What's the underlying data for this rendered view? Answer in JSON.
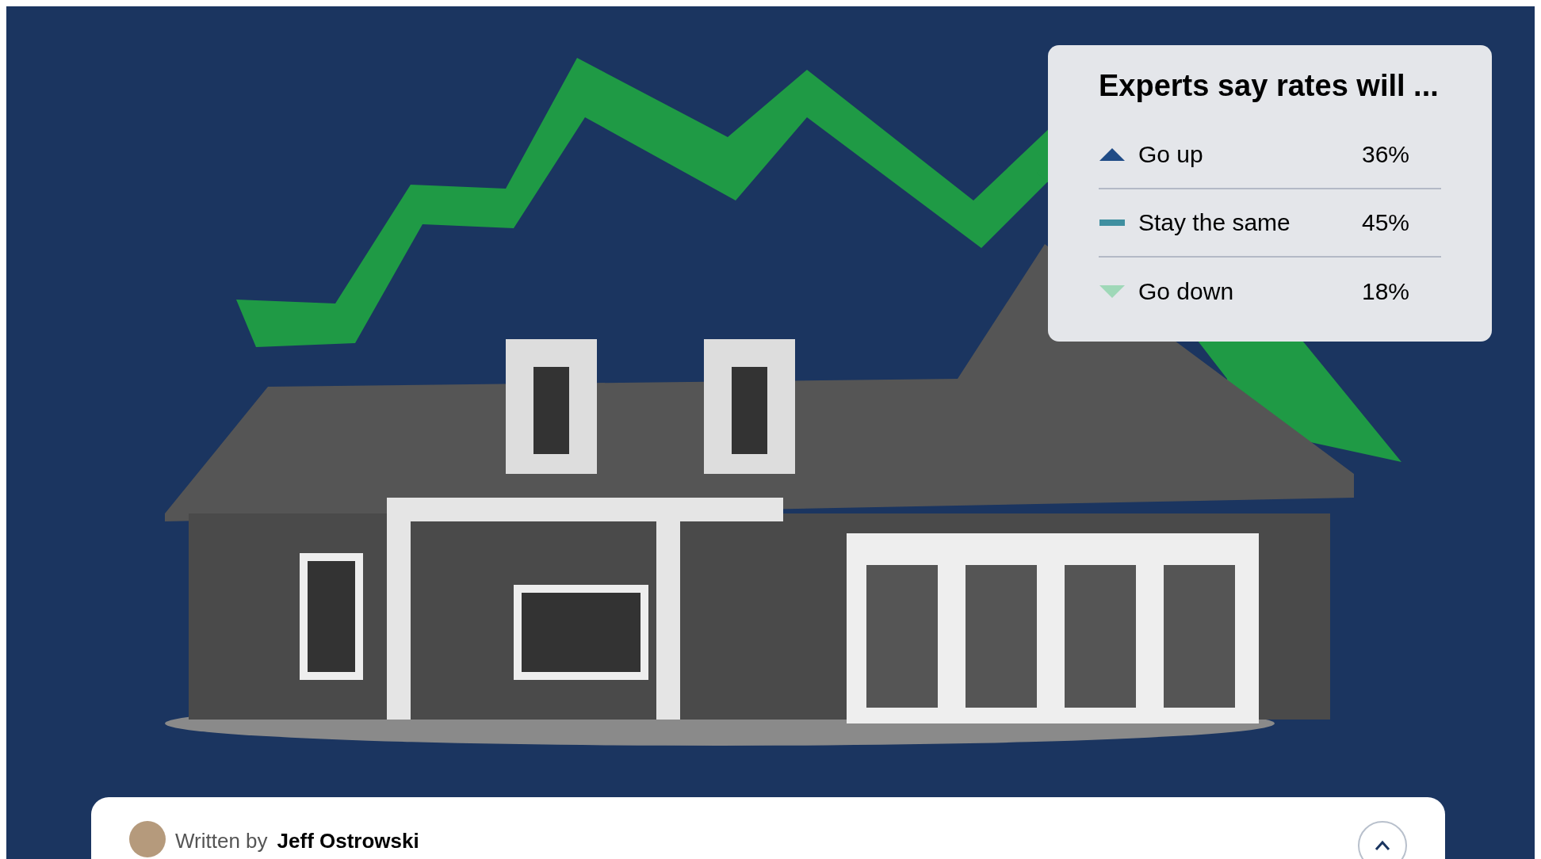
{
  "hero": {
    "card": {
      "title": "Experts say rates will ...",
      "options": [
        {
          "kind": "up",
          "label": "Go up",
          "percent": "36%"
        },
        {
          "kind": "same",
          "label": "Stay the same",
          "percent": "45%"
        },
        {
          "kind": "down",
          "label": "Go down",
          "percent": "18%"
        }
      ]
    }
  },
  "byline": {
    "prefix": "Written by",
    "author": "Jeff Ostrowski"
  }
}
